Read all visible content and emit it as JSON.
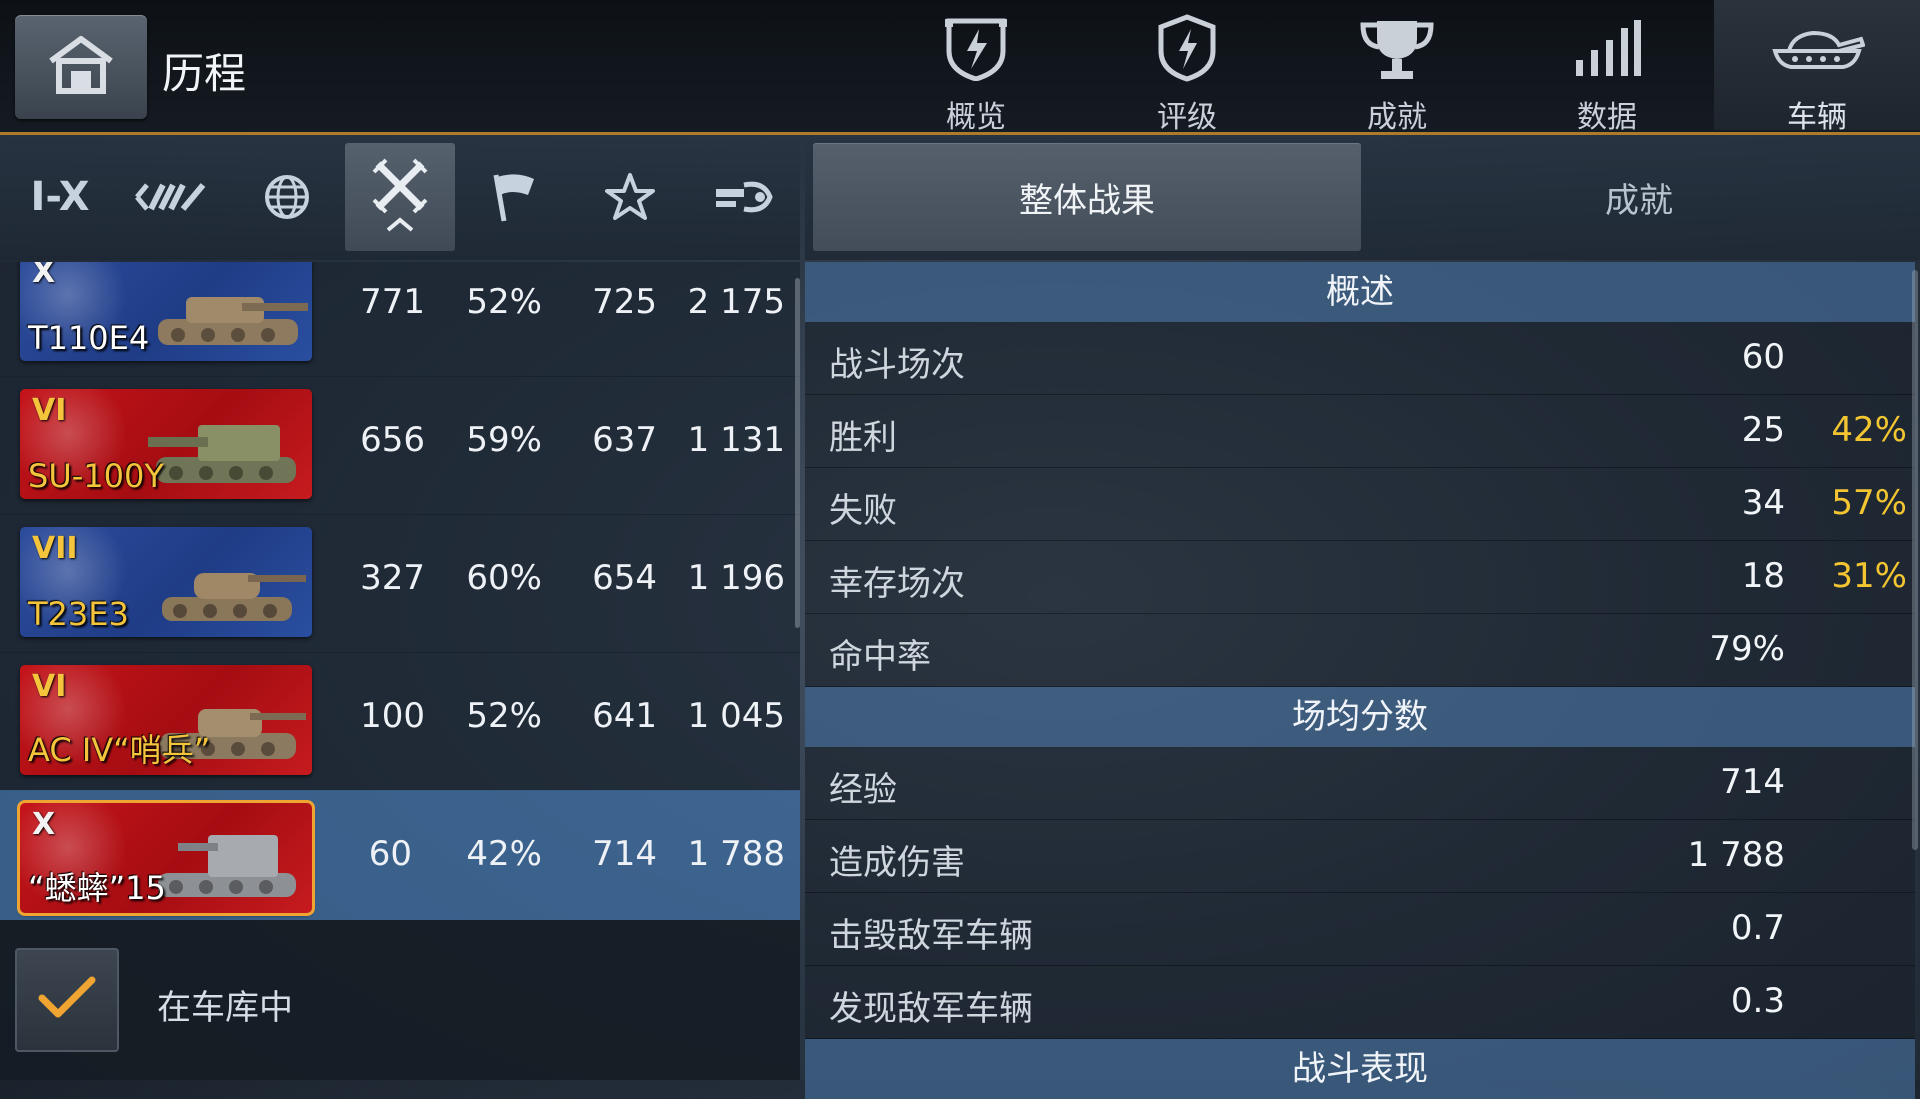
{
  "header": {
    "title": "历程",
    "tabs": [
      {
        "label": "概览",
        "icon": "shield-lightning-icon"
      },
      {
        "label": "评级",
        "icon": "rating-shield-icon"
      },
      {
        "label": "成就",
        "icon": "trophy-icon"
      },
      {
        "label": "数据",
        "icon": "bar-signal-icon"
      },
      {
        "label": "车辆",
        "icon": "tank-icon",
        "active": true
      }
    ]
  },
  "filters": {
    "tier_label": "I-X",
    "items": [
      "tier-filter",
      "class-filter-icon",
      "nation-globe-icon",
      "battle-swords-icon",
      "flag-icon",
      "star-icon",
      "gun-icon"
    ],
    "active": "battle-swords-icon"
  },
  "subtabs": {
    "overall": "整体战果",
    "achievements": "成就"
  },
  "vehicles": [
    {
      "tier": "X",
      "name": "T110E4",
      "nation": "usa",
      "battles": "771",
      "winrate": "52%",
      "exp": "725",
      "damage": "2 175"
    },
    {
      "tier": "VI",
      "name": "SU-100Y",
      "nation": "ussr",
      "battles": "656",
      "winrate": "59%",
      "exp": "637",
      "damage": "1 131"
    },
    {
      "tier": "VII",
      "name": "T23E3",
      "nation": "usa",
      "battles": "327",
      "winrate": "60%",
      "exp": "654",
      "damage": "1 196"
    },
    {
      "tier": "VI",
      "name": "AC IV“哨兵”",
      "nation": "ussr",
      "battles": "100",
      "winrate": "52%",
      "exp": "641",
      "damage": "1 045"
    },
    {
      "tier": "X",
      "name": "“蟋蟀”15",
      "nation": "ussr",
      "battles": "60",
      "winrate": "42%",
      "exp": "714",
      "damage": "1 788",
      "selected": true
    }
  ],
  "garage_filter": {
    "label": "在车库中",
    "checked": true
  },
  "stats": {
    "overview_title": "概述",
    "overview": [
      {
        "label": "战斗场次",
        "value": "60",
        "pct": ""
      },
      {
        "label": "胜利",
        "value": "25",
        "pct": "42%"
      },
      {
        "label": "失败",
        "value": "34",
        "pct": "57%"
      },
      {
        "label": "幸存场次",
        "value": "18",
        "pct": "31%"
      },
      {
        "label": "命中率",
        "value": "79%",
        "pct": ""
      }
    ],
    "avg_title": "场均分数",
    "avg": [
      {
        "label": "经验",
        "value": "714"
      },
      {
        "label": "造成伤害",
        "value": "1 788"
      },
      {
        "label": "击毁敌军车辆",
        "value": "0.7"
      },
      {
        "label": "发现敌军车辆",
        "value": "0.3"
      }
    ],
    "perf_title": "战斗表现"
  },
  "colors": {
    "accent": "#f2c531",
    "selected_row": "#406ea0",
    "header_divider": "#b07a2c"
  }
}
